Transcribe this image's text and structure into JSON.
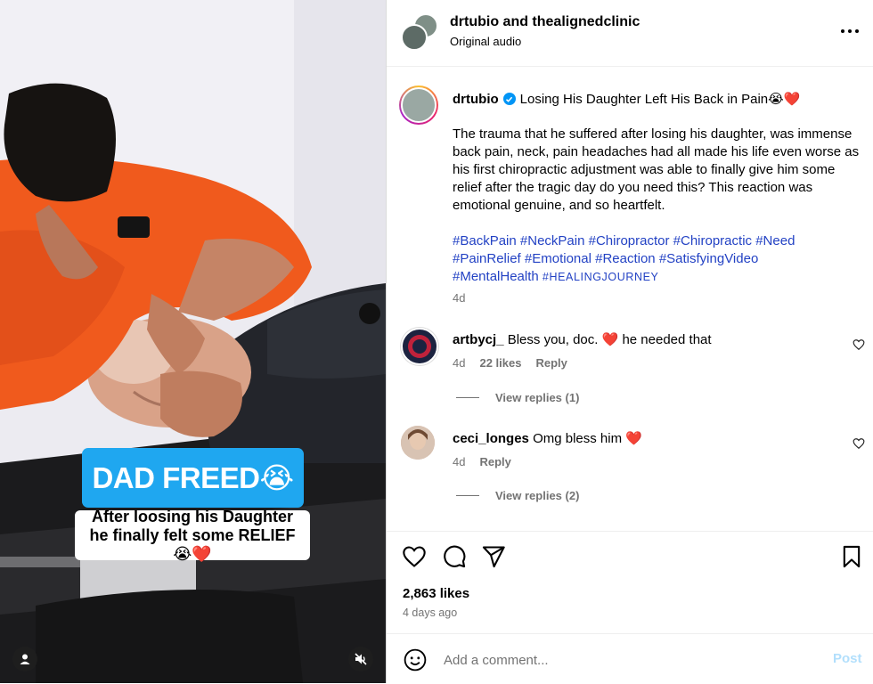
{
  "post": {
    "header": {
      "title": "drtubio and thealignedclinic",
      "subtitle": "Original audio"
    },
    "media": {
      "sticker_title": "DAD FREED😭",
      "sticker_caption": "After loosing his Daughter he finally felt some RELIEF😭❤️"
    },
    "caption": {
      "username": "drtubio",
      "title": "Losing His Daughter Left His Back in Pain😭❤️",
      "body": "The trauma that he suffered after losing his daughter, was immense back pain, neck, pain headaches had all made his life even worse as his first chiropractic adjustment was able to finally give him some relief after the tragic day do you need this? This reaction was emotional genuine, and so heartfelt.",
      "hashtags": [
        "#BackPain",
        "#NeckPain",
        "#Chiropractor",
        "#Chiropractic",
        "#Need",
        "#PainRelief",
        "#Emotional",
        "#Reaction",
        "#SatisfyingVideo",
        "#MentalHealth"
      ],
      "hashtag_smallcaps": "#HEALINGJOURNEY",
      "time": "4d"
    },
    "comments": [
      {
        "username": "artbycj_",
        "text": "Bless you, doc. ❤️ he needed that",
        "time": "4d",
        "likes": "22 likes",
        "reply": "Reply",
        "view_replies": "View replies (1)"
      },
      {
        "username": "ceci_longes",
        "text": "Omg bless him ❤️",
        "time": "4d",
        "reply": "Reply",
        "view_replies": "View replies (2)"
      }
    ],
    "likes": "2,863 likes",
    "posted": "4 days ago",
    "add_comment": {
      "placeholder": "Add a comment...",
      "post_label": "Post"
    }
  },
  "icons": [
    "more-icon",
    "verified-icon",
    "heart-icon",
    "comment-icon",
    "share-icon",
    "bookmark-icon",
    "emoji-icon",
    "user-tag-icon",
    "mute-icon"
  ],
  "colors": {
    "hashtag": "#2342c4",
    "verified": "#0095f6",
    "sticker": "#1fa7f0",
    "post_disabled": "#b2dffc",
    "heart": "#ed4956"
  }
}
